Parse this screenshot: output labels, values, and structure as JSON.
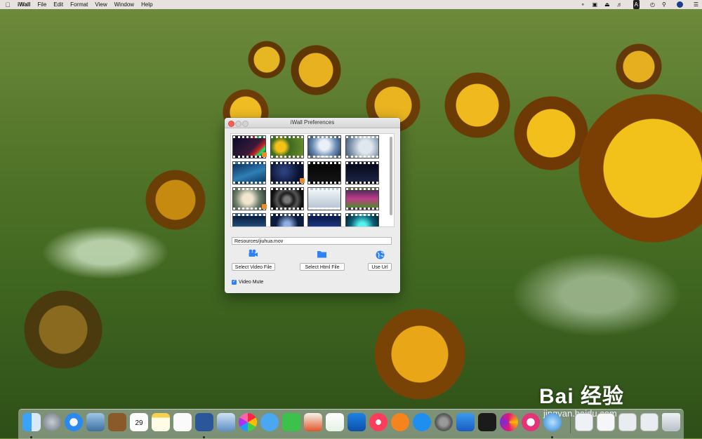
{
  "menubar": {
    "apple_icon": "apple-logo",
    "app_name": "iWall",
    "items": [
      "File",
      "Edit",
      "Format",
      "View",
      "Window",
      "Help"
    ],
    "status_keyboard": "A",
    "status_icons": [
      "wifi-icon",
      "airplay-icon",
      "eject-icon",
      "volume-icon",
      "keyboard-input-icon",
      "clock-icon",
      "search-icon",
      "user-avatar-icon",
      "notification-center-icon"
    ]
  },
  "window": {
    "title": "iWall Preferences",
    "file_path": "Resources/jiuhua.mov",
    "buttons": {
      "select_video": "Select Video File",
      "select_html": "Select Html File",
      "use_url": "Use Url"
    },
    "video_mute_label": "Video Mute",
    "video_mute_checked": true,
    "thumbnail_count": 16
  },
  "watermark": {
    "main": "Bai 经验",
    "sub": "jingyan.baidu.com"
  },
  "dock": {
    "apps": [
      "finder",
      "launchpad",
      "safari",
      "photos-preview",
      "contacts-book",
      "calendar",
      "notes",
      "reminders",
      "word",
      "preview",
      "photos",
      "qq-chat",
      "facetime",
      "keynote-pages",
      "numbers",
      "keynote",
      "itunes",
      "ibooks",
      "app-store",
      "system-preferences",
      "xcode",
      "terminal",
      "pinwheel",
      "paint",
      "iwall",
      "documents",
      "downloads",
      "folder",
      "stack",
      "trash"
    ],
    "calendar_day": "29"
  },
  "colors": {
    "accent": "#2e82f5",
    "close": "#fc5f57"
  }
}
